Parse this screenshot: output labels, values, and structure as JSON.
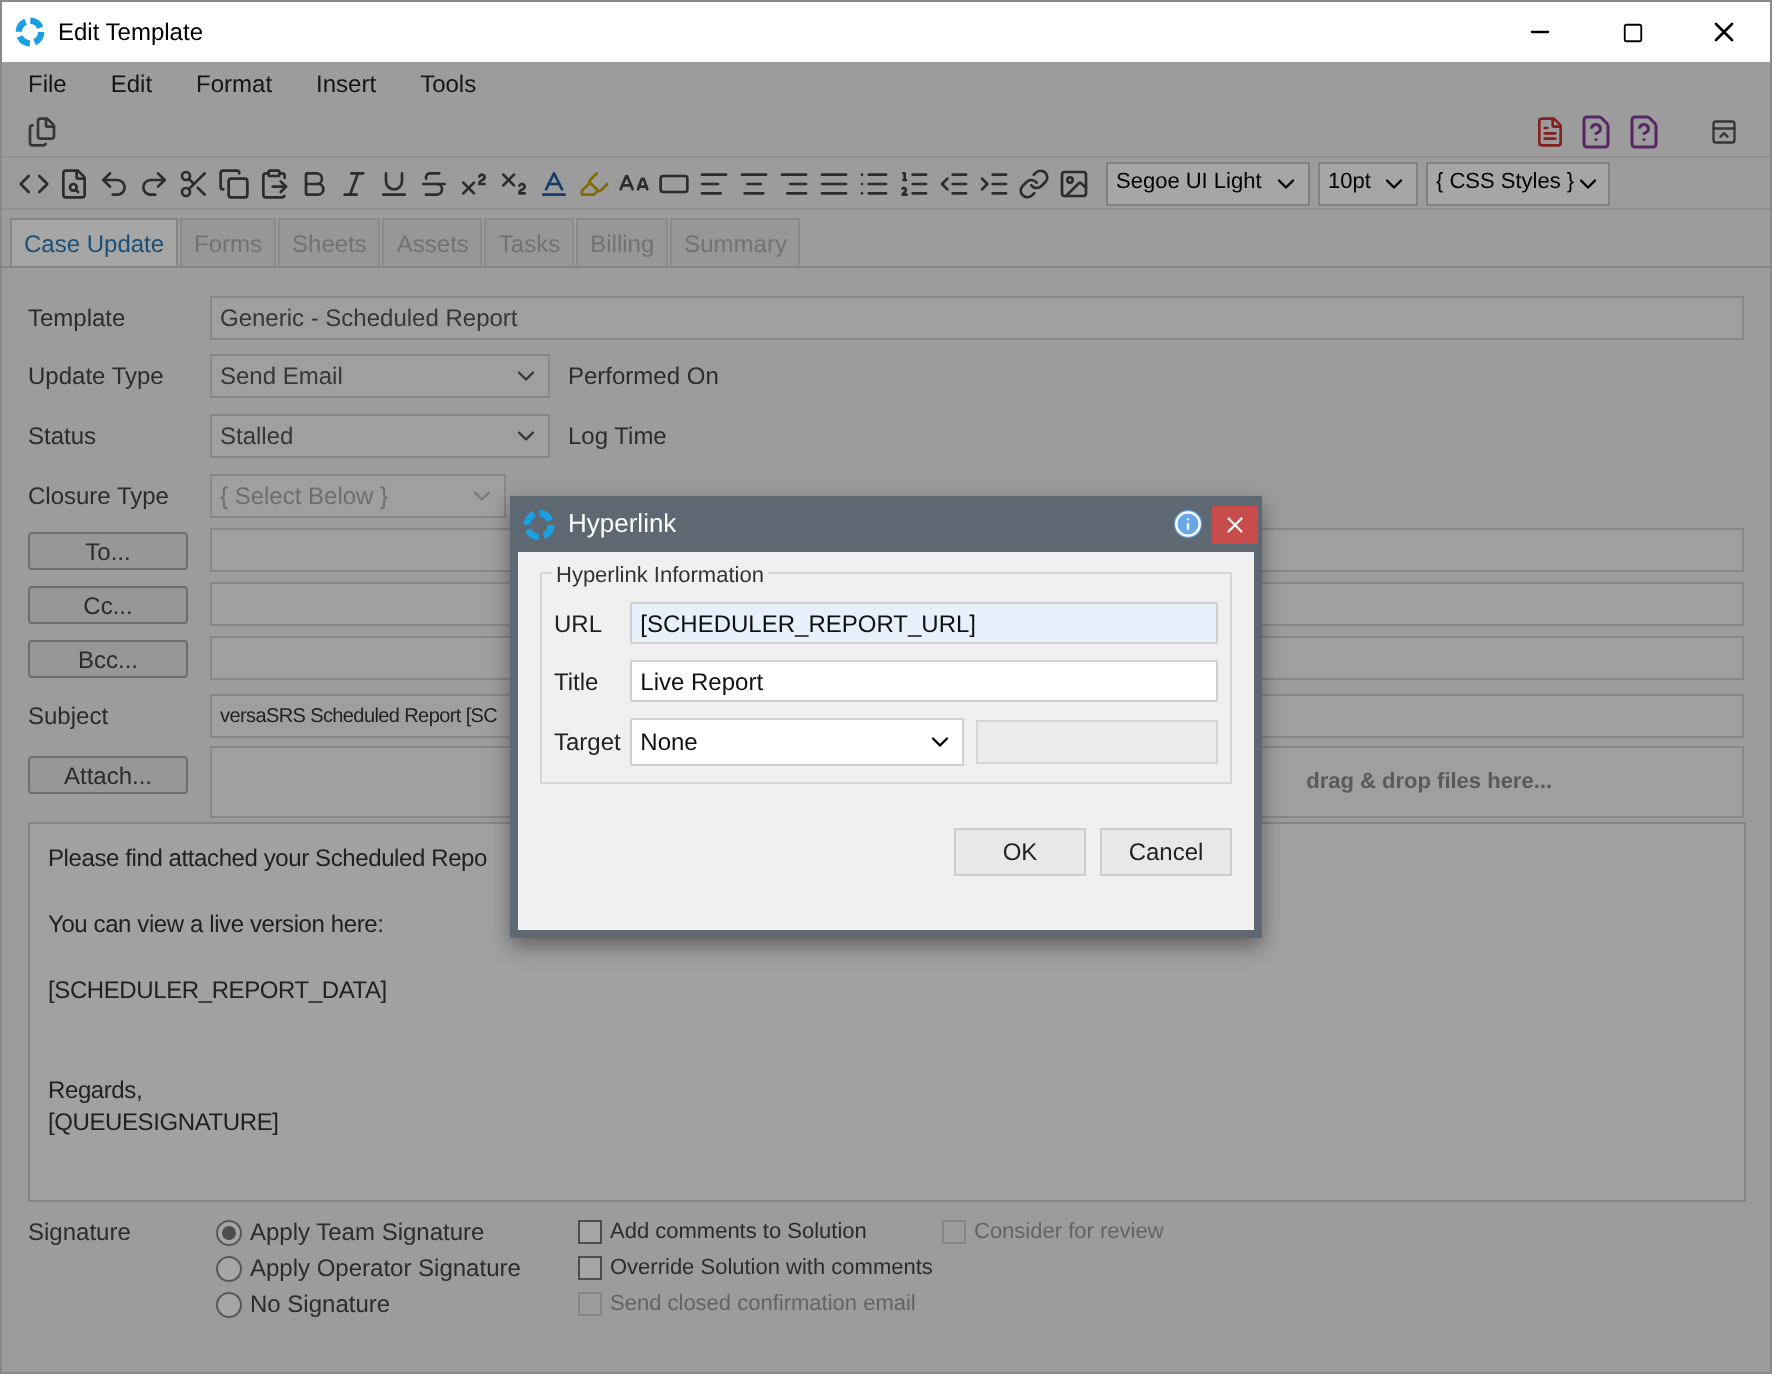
{
  "window": {
    "title": "Edit Template"
  },
  "menu": [
    "File",
    "Edit",
    "Format",
    "Insert",
    "Tools"
  ],
  "toolbar": {
    "font": "Segoe UI Light",
    "size": "10pt",
    "styles": "{ CSS Styles }"
  },
  "tabs": [
    {
      "label": "Case Update",
      "selected": true,
      "disabled": false
    },
    {
      "label": "Forms",
      "selected": false,
      "disabled": true
    },
    {
      "label": "Sheets",
      "selected": false,
      "disabled": true
    },
    {
      "label": "Assets",
      "selected": false,
      "disabled": true
    },
    {
      "label": "Tasks",
      "selected": false,
      "disabled": true
    },
    {
      "label": "Billing",
      "selected": false,
      "disabled": true
    },
    {
      "label": "Summary",
      "selected": false,
      "disabled": true
    }
  ],
  "form": {
    "template": {
      "label": "Template",
      "value": "Generic - Scheduled Report"
    },
    "update_type": {
      "label": "Update Type",
      "value": "Send Email",
      "side_label": "Performed On"
    },
    "status": {
      "label": "Status",
      "value": "Stalled",
      "side_label": "Log Time"
    },
    "closure_type": {
      "label": "Closure Type",
      "placeholder": "{ Select Below }",
      "disabled": true
    },
    "recipients": [
      {
        "button": "To..."
      },
      {
        "button": "Cc..."
      },
      {
        "button": "Bcc..."
      }
    ],
    "subject": {
      "label": "Subject",
      "value": "versaSRS Scheduled Report [SC"
    },
    "attach": {
      "button": "Attach...",
      "dropzone": "drag & drop files here..."
    }
  },
  "body": [
    [
      "Please find attached your Scheduled Repo"
    ],
    [
      "You can view a live version here:"
    ],
    [
      "[SCHEDULER_REPORT_DATA]"
    ],
    [
      "Regards,",
      "[QUEUESIGNATURE]"
    ]
  ],
  "signature": {
    "label": "Signature",
    "radios": [
      {
        "label": "Apply Team Signature",
        "selected": true
      },
      {
        "label": "Apply Operator Signature",
        "selected": false
      },
      {
        "label": "No Signature",
        "selected": false
      }
    ],
    "checkboxes": [
      {
        "label": "Add comments to Solution",
        "checked": false,
        "disabled": false
      },
      {
        "label": "Override Solution with comments",
        "checked": false,
        "disabled": false
      },
      {
        "label": "Send closed confirmation email",
        "checked": false,
        "disabled": true
      },
      {
        "label": "Consider for review",
        "checked": false,
        "disabled": true
      }
    ]
  },
  "dialog": {
    "title": "Hyperlink",
    "group": "Hyperlink Information",
    "url": {
      "label": "URL",
      "value": "[SCHEDULER_REPORT_URL]"
    },
    "link_title": {
      "label": "Title",
      "value": "Live Report"
    },
    "target": {
      "label": "Target",
      "value": "None"
    },
    "buttons": [
      "OK",
      "Cancel"
    ]
  }
}
